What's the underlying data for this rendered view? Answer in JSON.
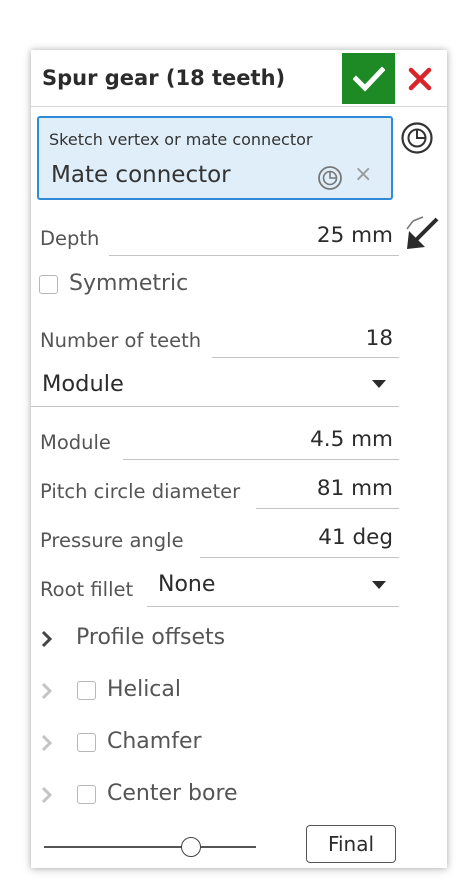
{
  "header": {
    "title": "Spur gear (18 teeth)"
  },
  "selection": {
    "label": "Sketch vertex or mate connector",
    "value": "Mate connector",
    "clear_glyph": "×"
  },
  "depth": {
    "label": "Depth",
    "value": "25 mm"
  },
  "symmetric": {
    "label": "Symmetric",
    "checked": false
  },
  "teeth": {
    "label": "Number of teeth",
    "value": "18"
  },
  "gear_mode": {
    "value": "Module"
  },
  "module": {
    "label": "Module",
    "value": "4.5 mm"
  },
  "pitch": {
    "label": "Pitch circle diameter",
    "value": "81 mm"
  },
  "pressure": {
    "label": "Pressure angle",
    "value": "41 deg"
  },
  "root_fillet": {
    "label": "Root fillet",
    "value": "None"
  },
  "sections": {
    "profile_offsets": "Profile offsets",
    "helical": "Helical",
    "chamfer": "Chamfer",
    "center_bore": "Center bore"
  },
  "footer": {
    "final_label": "Final",
    "slider_level": 0.75
  },
  "colors": {
    "accent_green": "#1d8a26",
    "cancel_red": "#d9252a",
    "selection_blue": "#2f8ad8",
    "selection_bg": "#dfeef9"
  },
  "icons": [
    "check-icon",
    "close-icon",
    "mate-connector-icon",
    "flip-direction-icon",
    "chevron-right-icon",
    "caret-down-icon"
  ]
}
